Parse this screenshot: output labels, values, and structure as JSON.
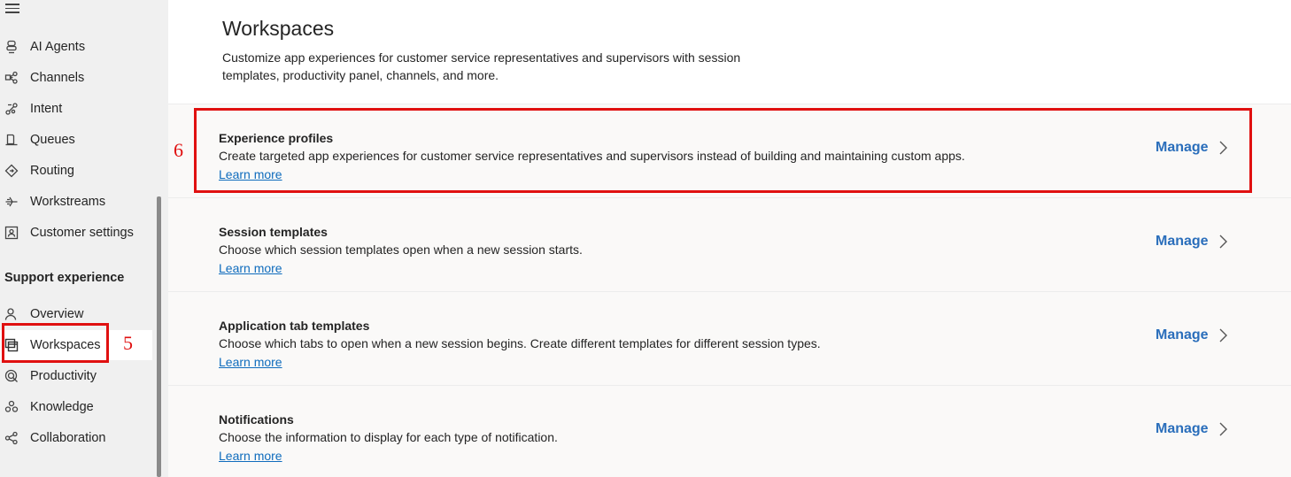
{
  "sidebar": {
    "items": [
      {
        "label": "AI Agents",
        "icon": "agent-icon"
      },
      {
        "label": "Channels",
        "icon": "channels-icon"
      },
      {
        "label": "Intent",
        "icon": "intent-icon"
      },
      {
        "label": "Queues",
        "icon": "queues-icon"
      },
      {
        "label": "Routing",
        "icon": "routing-icon"
      },
      {
        "label": "Workstreams",
        "icon": "workstreams-icon"
      },
      {
        "label": "Customer settings",
        "icon": "customer-settings-icon"
      }
    ],
    "section_title": "Support experience",
    "section_items": [
      {
        "label": "Overview",
        "icon": "overview-icon"
      },
      {
        "label": "Workspaces",
        "icon": "workspaces-icon",
        "selected": true
      },
      {
        "label": "Productivity",
        "icon": "productivity-icon"
      },
      {
        "label": "Knowledge",
        "icon": "knowledge-icon"
      },
      {
        "label": "Collaboration",
        "icon": "collaboration-icon"
      }
    ]
  },
  "main": {
    "title": "Workspaces",
    "description": "Customize app experiences for customer service representatives and supervisors with session templates, productivity panel, channels, and more.",
    "cards": [
      {
        "title": "Experience profiles",
        "description": "Create targeted app experiences for customer service representatives and supervisors instead of building and maintaining custom apps.",
        "link": "Learn more",
        "action": "Manage"
      },
      {
        "title": "Session templates",
        "description": "Choose which session templates open when a new session starts.",
        "link": "Learn more",
        "action": "Manage"
      },
      {
        "title": "Application tab templates",
        "description": "Choose which tabs to open when a new session begins. Create different templates for different session types.",
        "link": "Learn more",
        "action": "Manage"
      },
      {
        "title": "Notifications",
        "description": "Choose the information to display for each type of notification.",
        "link": "Learn more",
        "action": "Manage"
      }
    ]
  },
  "annotations": {
    "callout_5": "5",
    "callout_6": "6",
    "color": "#e01010"
  }
}
